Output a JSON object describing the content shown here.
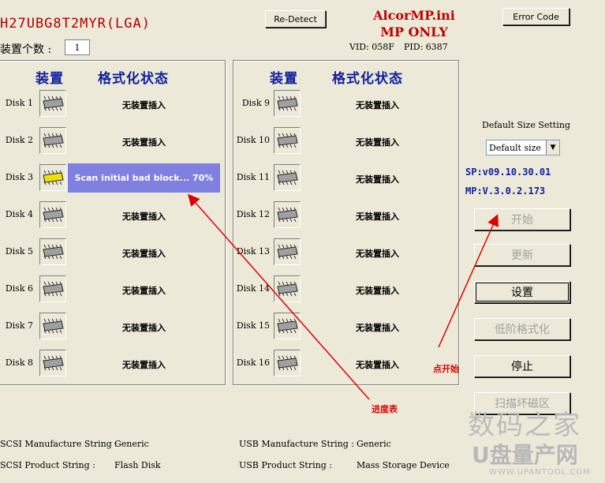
{
  "header": {
    "chip_id": "H27UBG8T2MYR(LGA)",
    "redetect_label": "Re-Detect",
    "ini_title": "AlcorMP.ini",
    "mode_title": "MP ONLY",
    "error_code_label": "Error Code",
    "device_count_label": "装置个数 :",
    "device_count_value": "1",
    "vid_label": "VID: 058F",
    "pid_label": "PID: 6387"
  },
  "left_panel": {
    "col_device": "装置",
    "col_status": "格式化状态",
    "disks": [
      {
        "name": "Disk 1",
        "status": "无装置插入",
        "active": false
      },
      {
        "name": "Disk 2",
        "status": "无装置插入",
        "active": false
      },
      {
        "name": "Disk 3",
        "status": "Scan initial bad block... 70%",
        "active": true,
        "progress": 70
      },
      {
        "name": "Disk 4",
        "status": "无装置插入",
        "active": false
      },
      {
        "name": "Disk 5",
        "status": "无装置插入",
        "active": false
      },
      {
        "name": "Disk 6",
        "status": "无装置插入",
        "active": false
      },
      {
        "name": "Disk 7",
        "status": "无装置插入",
        "active": false
      },
      {
        "name": "Disk 8",
        "status": "无装置插入",
        "active": false
      }
    ]
  },
  "right_panel": {
    "col_device": "装置",
    "col_status": "格式化状态",
    "disks": [
      {
        "name": "Disk 9",
        "status": "无装置插入"
      },
      {
        "name": "Disk 10",
        "status": "无装置插入"
      },
      {
        "name": "Disk 11",
        "status": "无装置插入"
      },
      {
        "name": "Disk 12",
        "status": "无装置插入"
      },
      {
        "name": "Disk 13",
        "status": "无装置插入"
      },
      {
        "name": "Disk 14",
        "status": "无装置插入"
      },
      {
        "name": "Disk 15",
        "status": "无装置插入"
      },
      {
        "name": "Disk 16",
        "status": "无装置插入"
      }
    ]
  },
  "side": {
    "default_size_setting_label": "Default Size Setting",
    "default_size_value": "Default size",
    "sp_version": "SP:v09.10.30.01",
    "mp_version": "MP:V.3.0.2.173",
    "start_label": "开始",
    "update_label": "更新",
    "settings_label": "设置",
    "low_format_label": "低阶格式化",
    "stop_label": "停止",
    "scan_bad_label": "扫描坏磁区"
  },
  "footer": {
    "scsi_mfr_label": "SCSI Manufacture String :",
    "scsi_mfr_value": "Generic",
    "scsi_prod_label": "SCSI Product String :",
    "scsi_prod_value": "Flash Disk",
    "usb_mfr_label": "USB Manufacture String :",
    "usb_mfr_value": "Generic",
    "usb_prod_label": "USB Product String :",
    "usb_prod_value": "Mass Storage Device"
  },
  "annotations": {
    "progress_note": "进度表",
    "start_note": "点开始"
  },
  "watermark": {
    "line1": "数码之家",
    "line2": "U盘量产网",
    "url": "WWW.UPANTOOL.COM"
  },
  "icons": {
    "chip": "chip-icon",
    "arrow": "annotation-arrow-icon"
  },
  "colors": {
    "active_chip": "#F0E000",
    "idle_chip": "#A0A0A0",
    "progress_bg": "#8080E0",
    "annotation": "#E00000"
  }
}
